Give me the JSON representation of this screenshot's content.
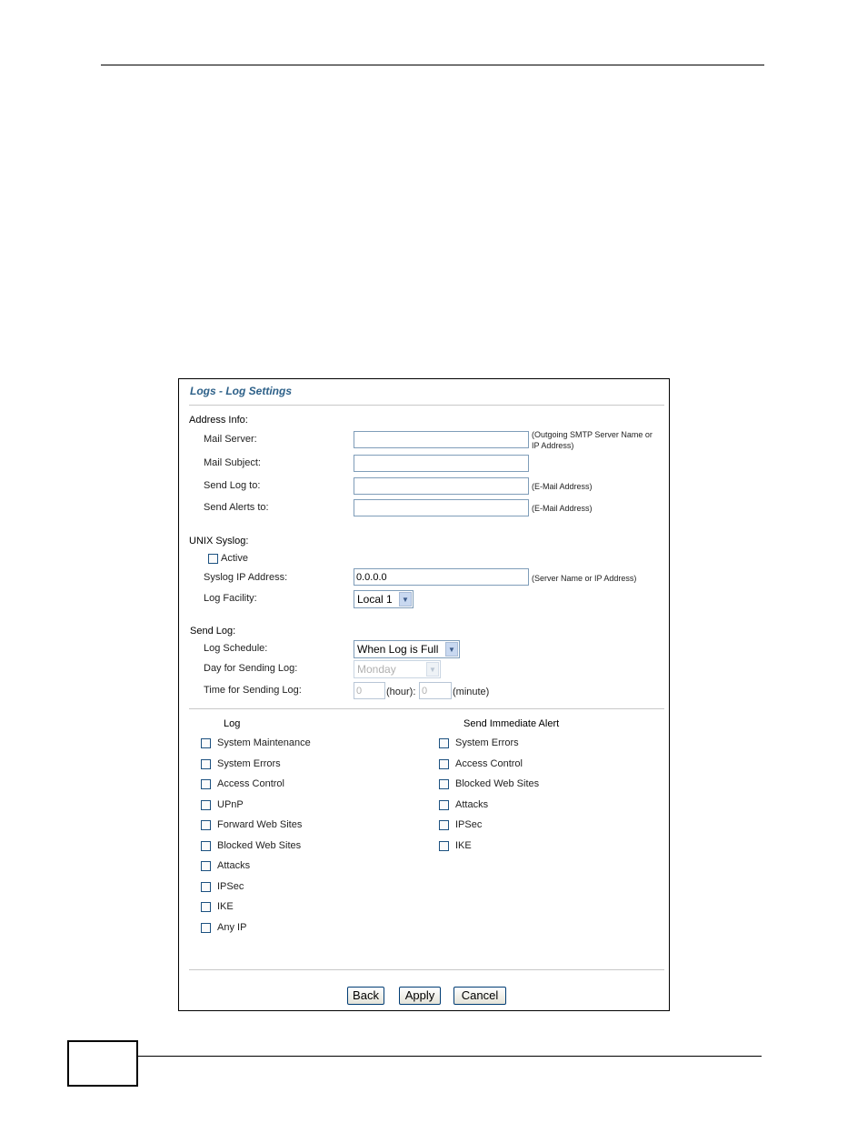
{
  "window": {
    "title": "Logs - Log Settings"
  },
  "address_info": {
    "heading": "Address Info:",
    "mail_server": {
      "label": "Mail Server:",
      "value": "",
      "hint_line1": "(Outgoing SMTP Server Name or",
      "hint_line2": "IP Address)"
    },
    "mail_subject": {
      "label": "Mail Subject:",
      "value": ""
    },
    "send_log_to": {
      "label": "Send Log to:",
      "value": "",
      "hint": "(E-Mail Address)"
    },
    "send_alerts_to": {
      "label": "Send Alerts to:",
      "value": "",
      "hint": "(E-Mail Address)"
    }
  },
  "unix_syslog": {
    "heading": "UNIX Syslog:",
    "active_label": "Active",
    "active_checked": false,
    "syslog_ip": {
      "label": "Syslog IP Address:",
      "value": "0.0.0.0",
      "hint": "(Server Name or IP Address)"
    },
    "log_facility": {
      "label": "Log Facility:",
      "value": "Local 1"
    }
  },
  "send_log": {
    "heading": "Send Log:",
    "log_schedule": {
      "label": "Log Schedule:",
      "value": "When Log is Full"
    },
    "day": {
      "label": "Day for Sending Log:",
      "value": "Monday"
    },
    "time": {
      "label": "Time for Sending Log:",
      "hour": "0",
      "hour_unit": "(hour):",
      "minute": "0",
      "minute_unit": "(minute)"
    }
  },
  "log_list": {
    "heading": "Log",
    "items": [
      "System Maintenance",
      "System Errors",
      "Access Control",
      "UPnP",
      "Forward Web Sites",
      "Blocked Web Sites",
      "Attacks",
      "IPSec",
      "IKE",
      "Any IP"
    ]
  },
  "alert_list": {
    "heading": "Send Immediate Alert",
    "items": [
      "System Errors",
      "Access Control",
      "Blocked Web Sites",
      "Attacks",
      "IPSec",
      "IKE"
    ]
  },
  "buttons": {
    "back": "Back",
    "apply": "Apply",
    "cancel": "Cancel"
  },
  "colors": {
    "title": "#2e6189",
    "input_border": "#7f9db9",
    "button_border": "#003c74"
  },
  "icons": {
    "dropdown": "chevron-down-icon"
  }
}
